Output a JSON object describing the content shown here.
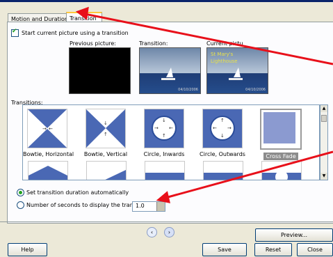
{
  "tabs": [
    "Motion and Duration",
    "Transition"
  ],
  "checkbox": {
    "label": "Start current picture using a transition",
    "checked": true
  },
  "previews": {
    "previous_label": "Previous picture:",
    "transition_label": "Transition:",
    "current_label": "Current pictu",
    "caption_line1": "St Mary's",
    "caption_line2": "Lighthouse",
    "stamp": "04/10/2006"
  },
  "transitions_label": "Transitions:",
  "transitions": [
    {
      "name": "Bowtie, Horizontal",
      "selected": false
    },
    {
      "name": "Bowtie, Vertical",
      "selected": false
    },
    {
      "name": "Circle, Inwards",
      "selected": false
    },
    {
      "name": "Circle, Outwards",
      "selected": false
    },
    {
      "name": "Cross Fade",
      "selected": true
    }
  ],
  "duration": {
    "auto_label": "Set transition duration automatically",
    "manual_label": "Number of seconds to display the transition",
    "auto_selected": true,
    "seconds_value": "1.0"
  },
  "buttons": {
    "preview": "Preview...",
    "help": "Help",
    "save": "Save",
    "reset": "Reset",
    "close": "Close"
  },
  "colors": {
    "arrow": "#e8101a",
    "transition_fill": "#4a68b4",
    "tab_highlight": "#ffc83c"
  }
}
